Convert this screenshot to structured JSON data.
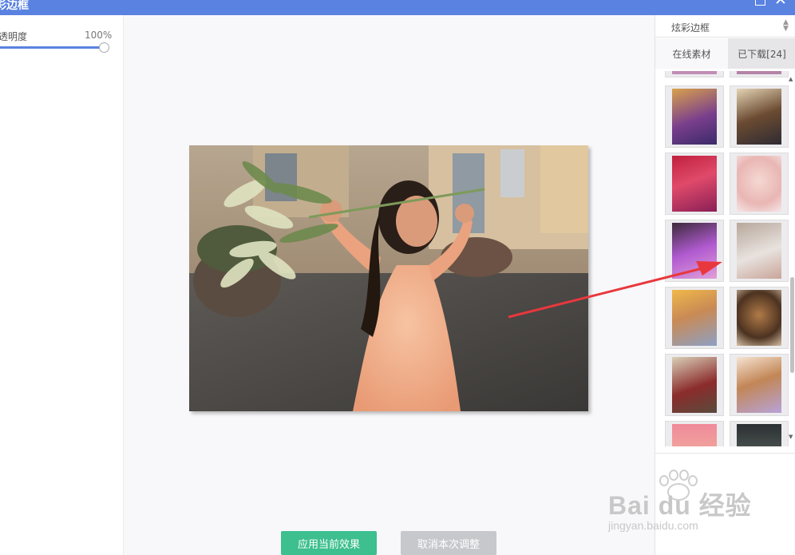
{
  "window": {
    "title": "彩边框",
    "maximize_icon": "maximize-icon",
    "close_icon": "close-icon",
    "close_glyph": "✕"
  },
  "left_panel": {
    "opacity_label": "透明度",
    "opacity_value": "100%",
    "opacity_percent": 100
  },
  "actions": {
    "apply_label": "应用当前效果",
    "cancel_label": "取消本次调整"
  },
  "right_panel": {
    "category_select": "炫彩边框",
    "tabs": [
      {
        "label": "在线素材",
        "active": true
      },
      {
        "label": "已下载[24]",
        "active": false
      }
    ],
    "thumbnails": [
      {
        "name": "frame-thumb-1"
      },
      {
        "name": "frame-thumb-2"
      },
      {
        "name": "frame-thumb-3"
      },
      {
        "name": "frame-thumb-4"
      },
      {
        "name": "frame-thumb-5"
      },
      {
        "name": "frame-thumb-6"
      },
      {
        "name": "frame-thumb-7"
      },
      {
        "name": "frame-thumb-8"
      },
      {
        "name": "frame-thumb-9"
      },
      {
        "name": "frame-thumb-10"
      }
    ]
  },
  "annotation": {
    "arrow_color": "#e8383d"
  },
  "watermark": {
    "main": "Bai du 经验",
    "sub": "jingyan.baidu.com"
  },
  "colors": {
    "accent": "#5a82e0",
    "apply_button": "#3dbf8f",
    "cancel_button": "#c6c8cc"
  }
}
